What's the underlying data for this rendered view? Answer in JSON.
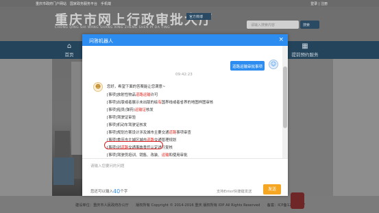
{
  "site": {
    "topbar_left": "重庆市政府门户网站　国家政务服务平台　手机端",
    "topbar_right": "登录 | 注册",
    "title": "重庆市网上行政审批大厅",
    "pinyin": "CHONG QING SHI WANG SHANG XING ZHENG SHEN PI DA TING",
    "weibo_label": "官方微博",
    "search_placeholder": "请输入搜索内容",
    "search_button": "搜索",
    "nav": [
      {
        "label": "首页",
        "icon": "home-icon"
      },
      {
        "label": "提前预约服务",
        "icon": "calendar-icon"
      }
    ]
  },
  "modal": {
    "title": "问答机器人",
    "close_label": "×",
    "user_message": "道路运输审批事项",
    "timestamp": "09:42:23",
    "bot_intro": "您好，希望下面的答案能让您满意~",
    "items": [
      {
        "prefix": "[事项]",
        "text": "放射性物品道路运输许可",
        "highlight": "道路运输"
      },
      {
        "prefix": "[事项]",
        "text": "出版或者展示未出版的绘有国界线或者省界的地图样图审核",
        "highlight": "有"
      },
      {
        "prefix": "[事项]",
        "text": "船员(弹药)运输证核发",
        "highlight": "运输证"
      },
      {
        "prefix": "[事项]",
        "text": "驾驶证审验",
        "highlight": ""
      },
      {
        "prefix": "[事项]",
        "text": "机动车驾驶证核发",
        "highlight": ""
      },
      {
        "prefix": "[事项]",
        "text": "规划方案设计涉及城市主要交通道路事项审查",
        "highlight": "道路"
      },
      {
        "prefix": "[事项]",
        "text": "重庆市主城区城市道路交通管理规划",
        "highlight": "道路"
      },
      {
        "prefix": "[事项]",
        "text": "对道路交通事故责任认定进行复核",
        "highlight": "道路"
      },
      {
        "prefix": "[事项]",
        "text": "驾驶员培训、销售、改装、运输和使用审批",
        "highlight": "运输"
      },
      {
        "prefix": "[事项]",
        "text": "机动车检验合格标志核发",
        "highlight": ""
      }
    ],
    "input_placeholder": "请输入您要问的问题",
    "counter_prefix": "您还可以输入",
    "counter_value": "40",
    "counter_suffix": "个字",
    "hint": "支持Enter快捷键发送",
    "send_label": "发送"
  },
  "footer": {
    "line1": "建设单位：重庆市人民政府办公厅　　版权所有 Copyright © 2014-2016 重庆 版权所有 IDP  All Rights Reserved　　备案：ICP备12007387"
  },
  "colors": {
    "accent": "#2d8cf0",
    "send": "#f5a623",
    "highlight": "#e2231a",
    "nav_bg": "#24445c"
  }
}
